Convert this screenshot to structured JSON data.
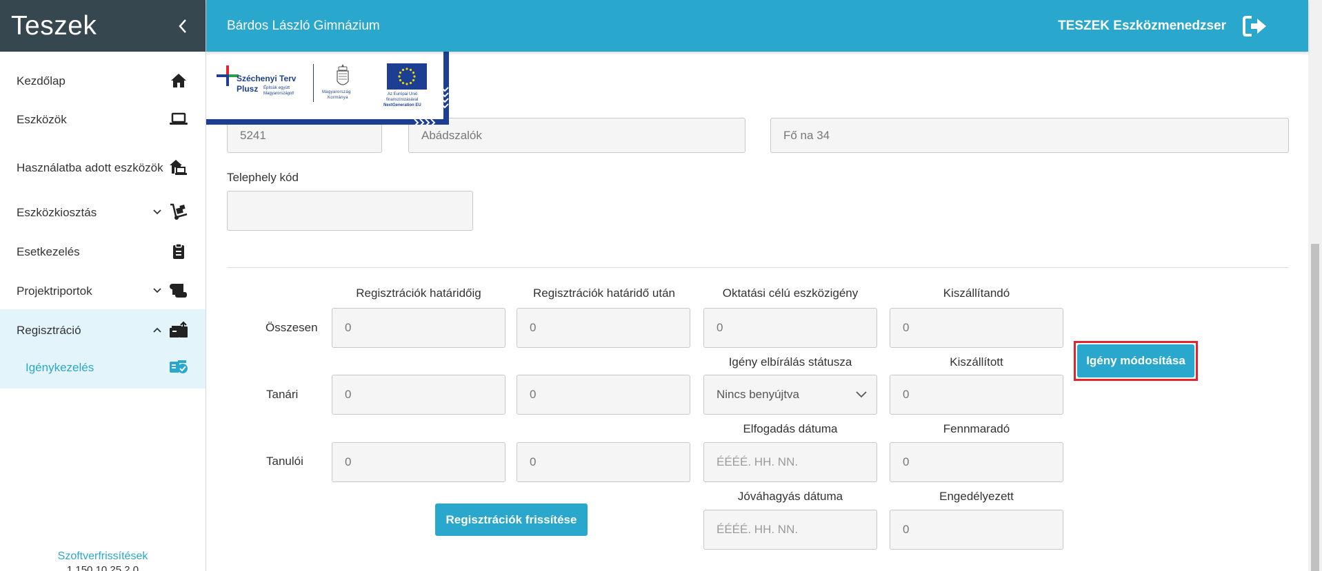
{
  "sidebar": {
    "app_name": "Teszek",
    "items": [
      {
        "label": "Kezdőlap"
      },
      {
        "label": "Eszközök"
      },
      {
        "label": "Használatba adott eszközök"
      },
      {
        "label": "Eszközkiosztás"
      },
      {
        "label": "Esetkezelés"
      },
      {
        "label": "Projektriportok"
      },
      {
        "label": "Regisztráció"
      },
      {
        "label": "Igénykezelés"
      }
    ],
    "footer_link": "Szoftverfrissítések",
    "version": "1.150.10.25.2.0"
  },
  "topbar": {
    "school_name": "Bárdos László Gimnázium",
    "app_title": "TESZEK Eszközmenedzser"
  },
  "banner": {
    "szechenyi_line1": "Széchenyi Terv",
    "szechenyi_line2": "Plusz",
    "szechenyi_tag1": "Építsük együtt",
    "szechenyi_tag2": "Magyarországot!",
    "gov_line1": "Magyarország",
    "gov_line2": "Kormánya",
    "eu_line1": "Az Európai Unió",
    "eu_line2": "finanszírozásával",
    "eu_line3": "NextGeneration EU"
  },
  "address": {
    "zip": "5241",
    "city": "Abádszalók",
    "street": "Fő na 34"
  },
  "site_code": {
    "label": "Telephely kód",
    "value": ""
  },
  "registrations": {
    "columns": [
      "Regisztrációk határidőig",
      "Regisztrációk határidő után",
      "Oktatási célú eszközigény",
      "Kiszállítandó"
    ],
    "rows": [
      {
        "label": "Összesen",
        "values": [
          "0",
          "0",
          "0",
          "0"
        ]
      },
      {
        "label": "Tanári",
        "values": [
          "0",
          "0"
        ]
      },
      {
        "label": "Tanulói",
        "values": [
          "0",
          "0"
        ]
      }
    ],
    "status_label": "Igény elbírálás státusza",
    "status_value": "Nincs benyújtva",
    "delivered_label": "Kiszállított",
    "delivered_value": "0",
    "accept_date_label": "Elfogadás dátuma",
    "accept_date_placeholder": "ÉÉÉÉ. HH. NN.",
    "remaining_label": "Fennmaradó",
    "remaining_value": "0",
    "approve_date_label": "Jóváhagyás dátuma",
    "approve_date_placeholder": "ÉÉÉÉ. HH. NN.",
    "approved_label": "Engedélyezett",
    "approved_value": "0",
    "refresh_button": "Regisztrációk frissítése",
    "modify_button": "Igény módosítása"
  },
  "colors": {
    "primary": "#2aa7cc",
    "sidebar_header": "#37474f",
    "active_bg": "#e3f4fa",
    "highlight": "#e0242d"
  }
}
